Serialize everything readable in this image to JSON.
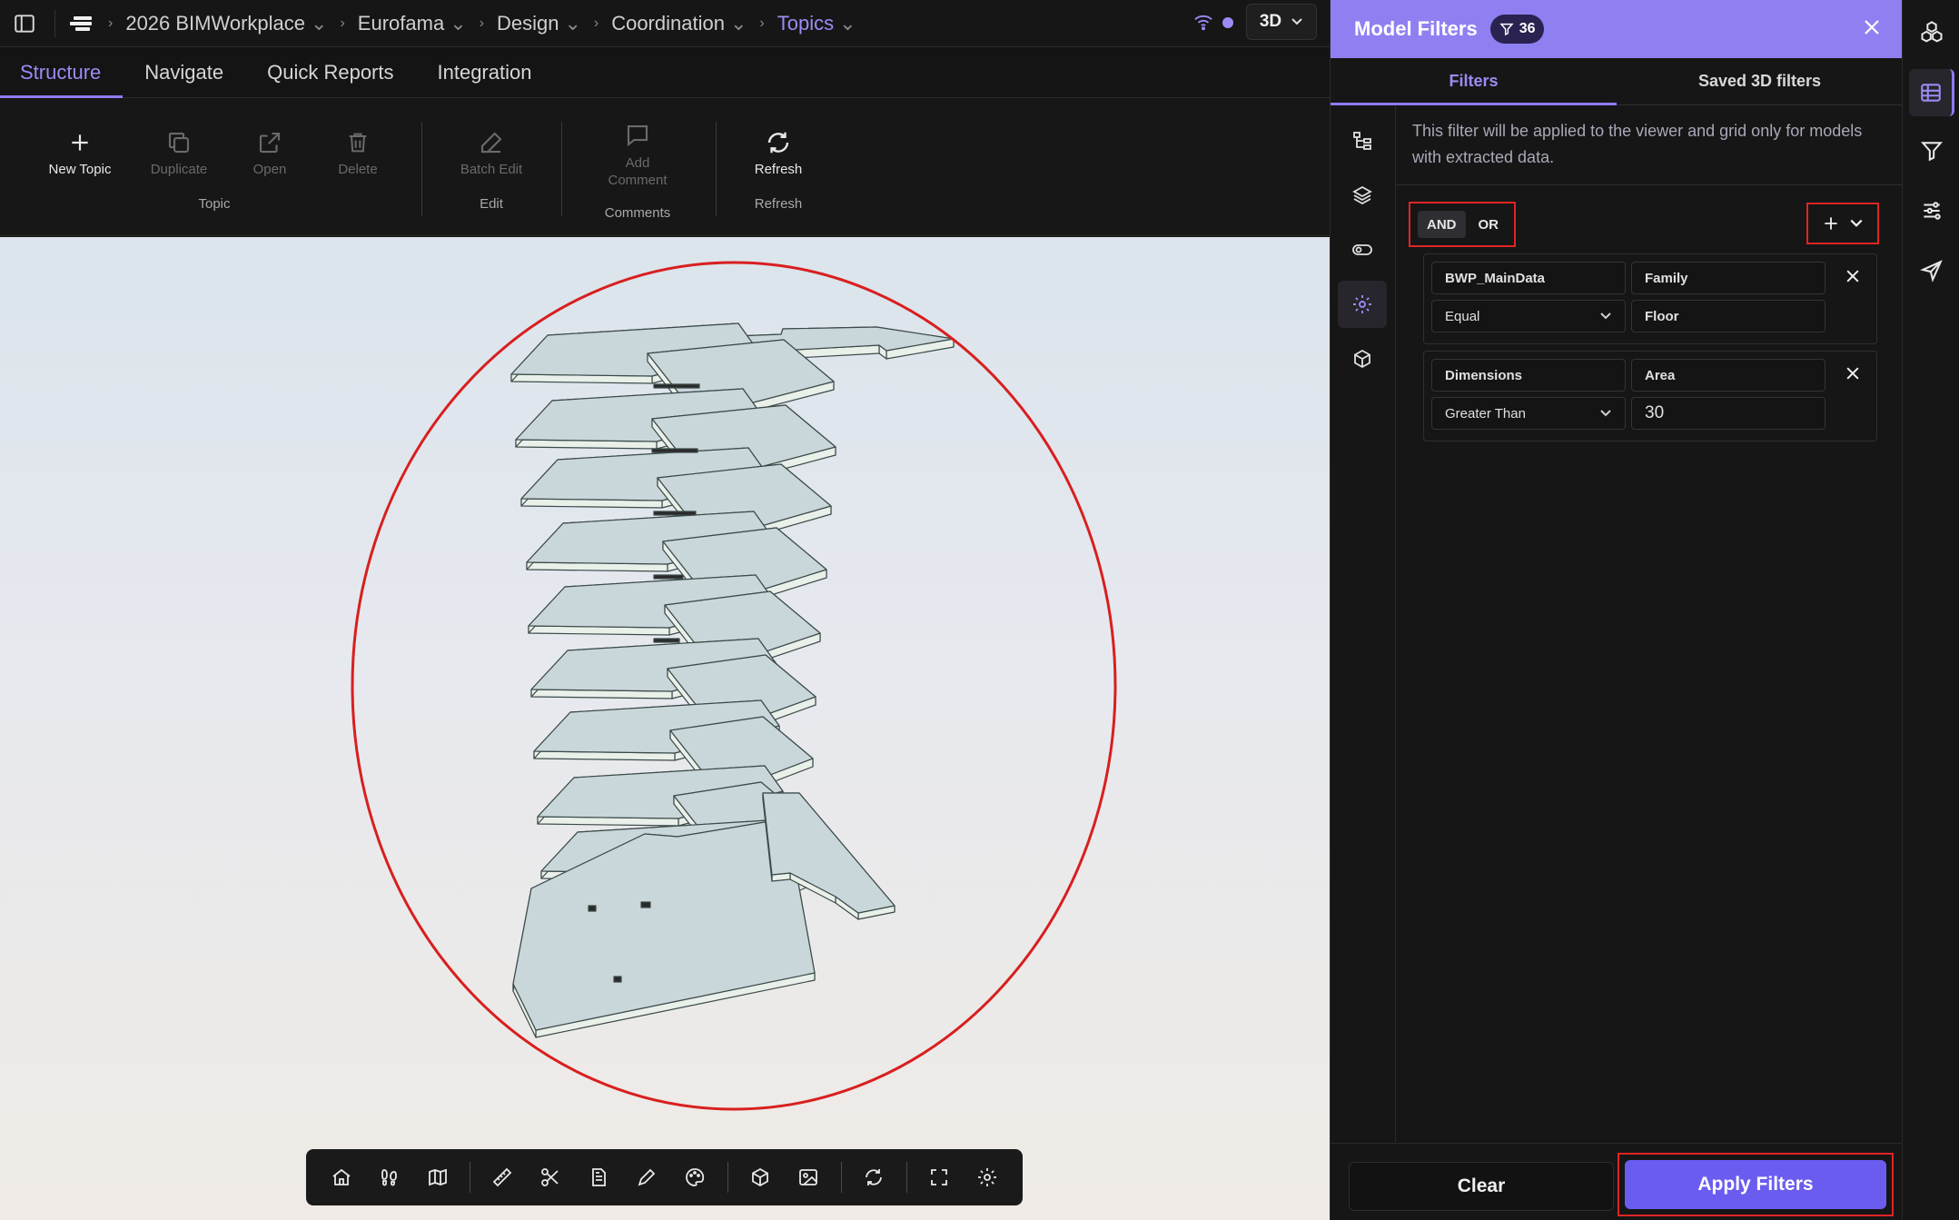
{
  "breadcrumb": {
    "items": [
      "2026 BIMWorkplace",
      "Eurofama",
      "Design",
      "Coordination",
      "Topics"
    ]
  },
  "view_mode": "3D",
  "ribbon": {
    "tabs": [
      "Structure",
      "Navigate",
      "Quick Reports",
      "Integration"
    ],
    "active_tab": "Structure",
    "tools": {
      "new_topic": "New Topic",
      "duplicate": "Duplicate",
      "open": "Open",
      "delete": "Delete",
      "batch_edit": "Batch Edit",
      "add_comment": "Add Comment",
      "refresh": "Refresh"
    },
    "groups": {
      "topic": "Topic",
      "edit": "Edit",
      "comments": "Comments",
      "refresh": "Refresh"
    }
  },
  "panel": {
    "title": "Model Filters",
    "badge_count": "36",
    "tabs": [
      "Filters",
      "Saved 3D filters"
    ],
    "info": "This filter will be applied to the viewer and grid only for models with extracted data.",
    "logic": {
      "and": "AND",
      "or": "OR",
      "active": "AND"
    },
    "rules": [
      {
        "category": "BWP_MainData",
        "property": "Family",
        "operator": "Equal",
        "value": "Floor"
      },
      {
        "category": "Dimensions",
        "property": "Area",
        "operator": "Greater Than",
        "value": "30"
      }
    ],
    "clear_label": "Clear",
    "apply_label": "Apply Filters"
  },
  "colors": {
    "accent": "#8f80f2",
    "apply": "#6b5cf0",
    "highlight": "#e02424"
  }
}
